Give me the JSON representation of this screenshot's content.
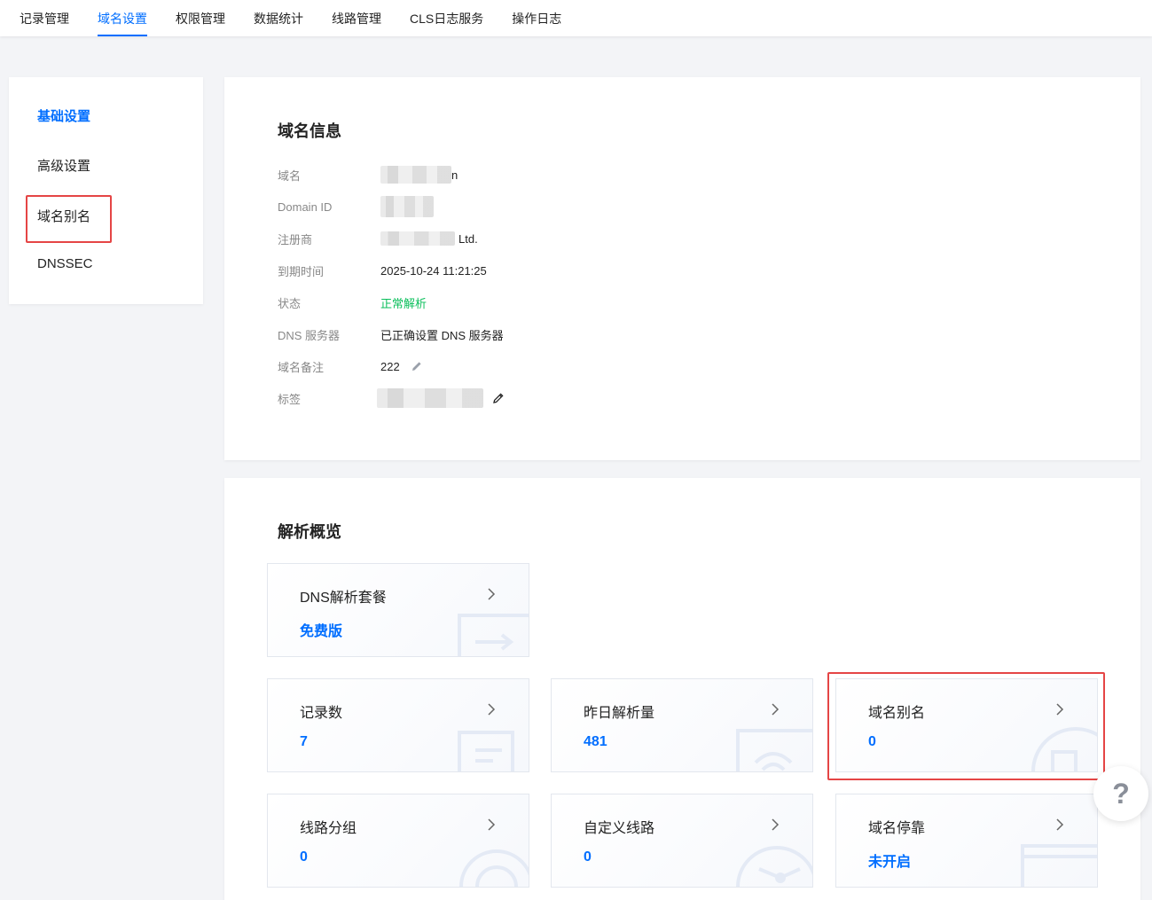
{
  "nav": {
    "tabs": [
      {
        "label": "记录管理",
        "active": false
      },
      {
        "label": "域名设置",
        "active": true
      },
      {
        "label": "权限管理",
        "active": false
      },
      {
        "label": "数据统计",
        "active": false
      },
      {
        "label": "线路管理",
        "active": false
      },
      {
        "label": "CLS日志服务",
        "active": false
      },
      {
        "label": "操作日志",
        "active": false
      }
    ]
  },
  "sidebar": {
    "items": [
      {
        "label": "基础设置",
        "active": true
      },
      {
        "label": "高级设置",
        "active": false
      },
      {
        "label": "域名别名",
        "active": false
      },
      {
        "label": "DNSSEC",
        "active": false
      }
    ]
  },
  "domain_info": {
    "title": "域名信息",
    "rows": [
      {
        "label": "域名",
        "value": "n",
        "blurred": true
      },
      {
        "label": "Domain ID",
        "value": "",
        "blurred": true
      },
      {
        "label": "注册商",
        "value": "Ltd.",
        "blurred": true
      },
      {
        "label": "到期时间",
        "value": "2025-10-24 11:21:25",
        "blurred": false
      },
      {
        "label": "状态",
        "value": "正常解析",
        "blurred": false
      },
      {
        "label": "DNS 服务器",
        "value": "已正确设置 DNS 服务器",
        "blurred": false
      },
      {
        "label": "域名备注",
        "value": "222",
        "blurred": false,
        "editable": true
      },
      {
        "label": "标签",
        "value": "",
        "blurred": true,
        "editable": true
      }
    ]
  },
  "overview": {
    "title": "解析概览",
    "cards": [
      {
        "label": "DNS解析套餐",
        "value": "免费版"
      },
      {
        "label": "记录数",
        "value": "7"
      },
      {
        "label": "昨日解析量",
        "value": "481"
      },
      {
        "label": "域名别名",
        "value": "0"
      },
      {
        "label": "线路分组",
        "value": "0"
      },
      {
        "label": "自定义线路",
        "value": "0"
      },
      {
        "label": "域名停靠",
        "value": "未开启"
      }
    ]
  },
  "help": {
    "label": "?"
  },
  "icons": {
    "edit": "pencil-icon",
    "arrow": "chevron-right-icon",
    "help": "question-icon"
  },
  "colors": {
    "accent": "#006eff",
    "success": "#0abf5b",
    "highlight": "#e54545"
  }
}
